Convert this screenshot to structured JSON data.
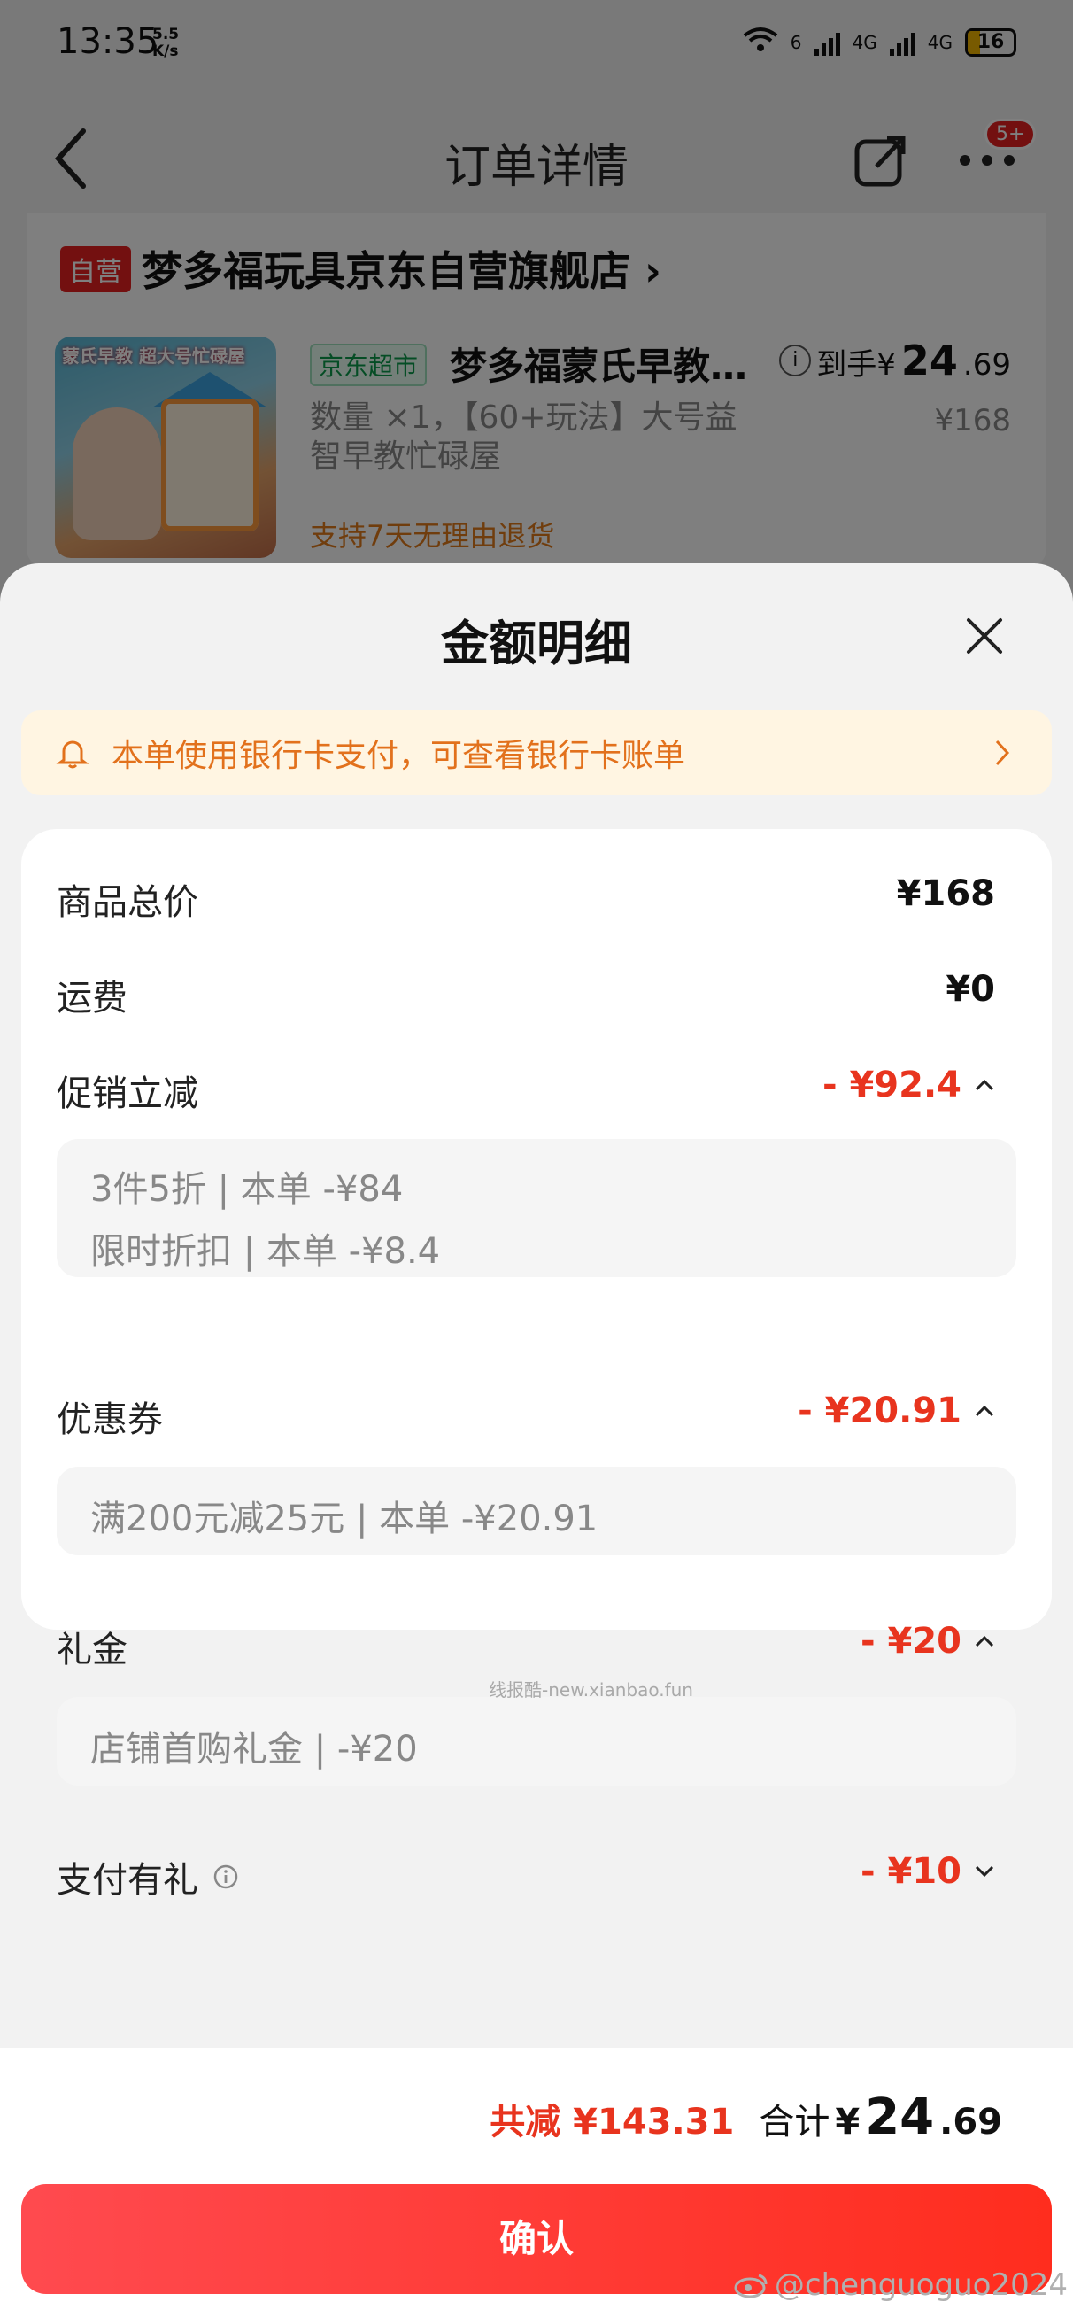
{
  "status_bar": {
    "time": "13:35",
    "speed_value": "5.5",
    "speed_unit": "K/s",
    "net1": "6",
    "net2": "4G",
    "net3": "4G",
    "battery": "16"
  },
  "nav": {
    "title": "订单详情",
    "badge": "5+"
  },
  "store": {
    "tag": "自营",
    "name": "梦多福玩具京东自营旗舰店",
    "chevron": "›"
  },
  "product": {
    "image_text": "蒙氏早教 超大号忙碌屋",
    "channel_tag": "京东超市",
    "title": "梦多福蒙氏早教…",
    "price_prefix": "到手¥",
    "price_int": "24",
    "price_dec": ".69",
    "desc": "数量 ×1，【60+玩法】大号益智早教忙碌屋",
    "orig_price": "¥168",
    "return_policy": "支持7天无理由退货"
  },
  "sheet": {
    "title": "金额明细",
    "notice": "本单使用银行卡支付，可查看银行卡账单",
    "rows": {
      "total": {
        "label": "商品总价",
        "value": "¥168"
      },
      "shipping": {
        "label": "运费",
        "value": "¥0"
      },
      "promo": {
        "label": "促销立减",
        "value": "- ¥92.4",
        "items": [
          "3件5折 | 本单 -¥84",
          "限时折扣 | 本单 -¥8.4"
        ]
      },
      "coupon": {
        "label": "优惠券",
        "value": "- ¥20.91",
        "items": [
          "满200元减25元 | 本单 -¥20.91"
        ]
      },
      "gift": {
        "label": "礼金",
        "value": "- ¥20",
        "items": [
          "店铺首购礼金 | -¥20"
        ]
      },
      "pay_gift": {
        "label": "支付有礼",
        "value": "- ¥10"
      }
    },
    "watermark": "线报酷-new.xianbao.fun"
  },
  "footer": {
    "discount_label": "共减 ¥143.31",
    "total_label": "合计",
    "total_currency": "¥",
    "total_int": "24",
    "total_dec": ".69",
    "confirm": "确认"
  },
  "watermark_weibo": "@chenguoguo2024",
  "colors": {
    "accent_red": "#e8341e",
    "notice_orange": "#e2711c",
    "notice_bg": "#fff5e2",
    "button_red": "#ff3b30"
  }
}
